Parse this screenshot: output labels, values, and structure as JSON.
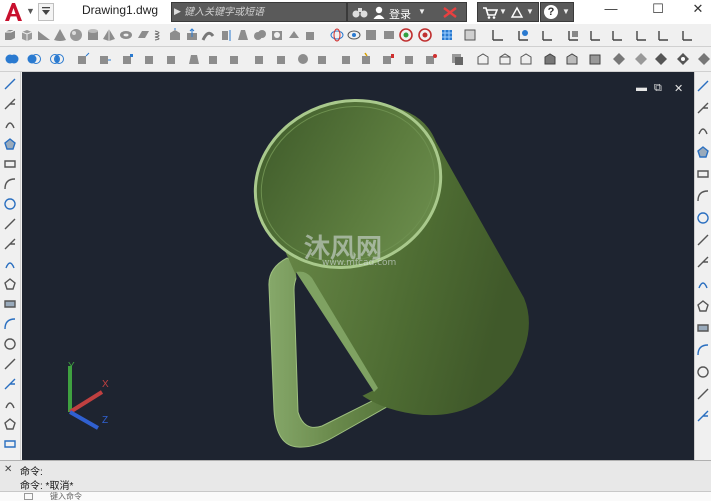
{
  "app": {
    "file_name": "Drawing1.dwg"
  },
  "search": {
    "placeholder": "键入关键字或短语"
  },
  "account": {
    "login_label": "登录"
  },
  "help": {
    "glyph": "?"
  },
  "window_controls": {
    "minimize": "—",
    "restore": "☐",
    "close": "✕"
  },
  "viewport_controls": {
    "minimize": "▬",
    "restore": "⧉",
    "close": "✕"
  },
  "ucs": {
    "x": "X",
    "y": "Y",
    "z": "Z"
  },
  "watermark": {
    "title": "沐风网",
    "url": "www.mfcad.com"
  },
  "command": {
    "history": [
      "命令:",
      "命令: *取消*"
    ],
    "input_prompt": "键入命令"
  },
  "colors": {
    "viewport_bg": "#1e2430",
    "mug": "#5b7a3e",
    "logo_red": "#c8102e"
  },
  "icons": {
    "left": [
      "line-icon",
      "polyline-icon",
      "arc-icon",
      "polygon-icon",
      "rectangle-icon",
      "arc2-icon",
      "circle-icon",
      "revision-cloud-icon",
      "spline-icon",
      "ellipse-icon",
      "ellipse-arc-icon",
      "insert-block-icon",
      "make-block-icon",
      "point-icon",
      "hatch-icon",
      "gradient-icon",
      "region-icon",
      "table-icon",
      "text-icon"
    ],
    "right": [
      "erase-icon",
      "copy-icon",
      "mirror-icon",
      "offset-icon",
      "array-icon",
      "move-icon",
      "rotate-icon",
      "scale-icon",
      "stretch-icon",
      "trim-icon",
      "extend-icon",
      "break-icon",
      "join-icon",
      "chamfer-icon",
      "fillet-icon",
      "explode-icon"
    ]
  }
}
